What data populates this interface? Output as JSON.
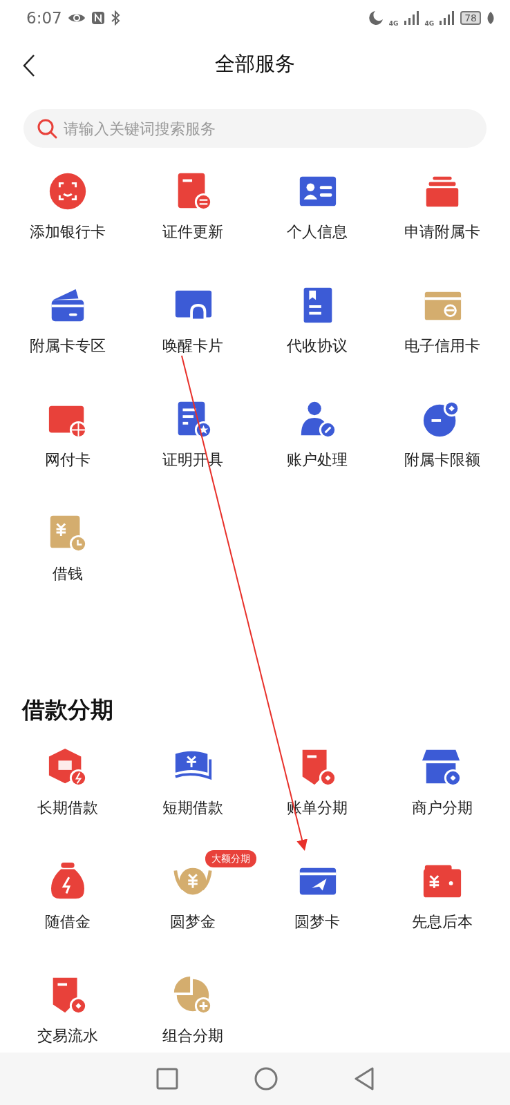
{
  "status_bar": {
    "time": "6:07",
    "network_1": "4G",
    "network_2": "4G",
    "battery": "78"
  },
  "header": {
    "title": "全部服务"
  },
  "search": {
    "placeholder": "请输入关键词搜索服务"
  },
  "services": [
    {
      "label": "添加银行卡"
    },
    {
      "label": "证件更新"
    },
    {
      "label": "个人信息"
    },
    {
      "label": "申请附属卡"
    },
    {
      "label": "附属卡专区"
    },
    {
      "label": "唤醒卡片"
    },
    {
      "label": "代收协议"
    },
    {
      "label": "电子信用卡"
    },
    {
      "label": "网付卡"
    },
    {
      "label": "证明开具"
    },
    {
      "label": "账户处理"
    },
    {
      "label": "附属卡限额"
    },
    {
      "label": "借钱"
    }
  ],
  "loan_section": {
    "title": "借款分期",
    "items": [
      {
        "label": "长期借款"
      },
      {
        "label": "短期借款"
      },
      {
        "label": "账单分期"
      },
      {
        "label": "商户分期"
      },
      {
        "label": "随借金"
      },
      {
        "label": "圆梦金",
        "badge": "大额分期"
      },
      {
        "label": "圆梦卡"
      },
      {
        "label": "先息后本"
      },
      {
        "label": "交易流水"
      },
      {
        "label": "组合分期"
      }
    ]
  }
}
